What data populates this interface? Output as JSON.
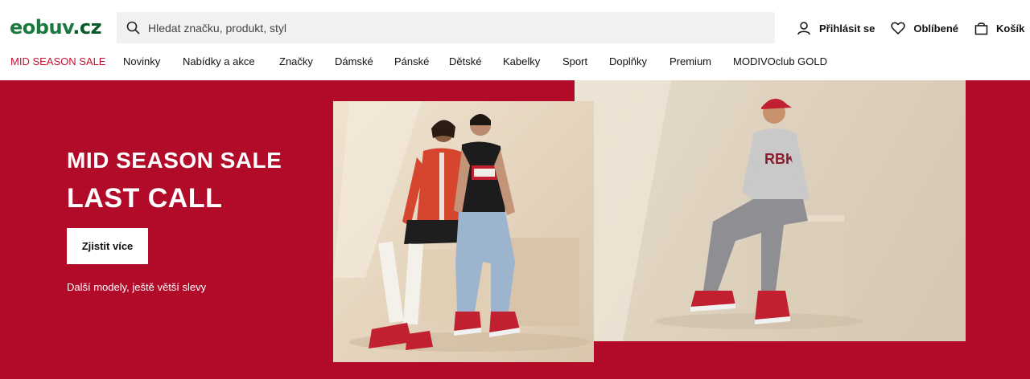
{
  "header": {
    "logo_main": "eobuv",
    "logo_tld": ".cz",
    "search_placeholder": "Hledat značku, produkt, styl",
    "actions": {
      "login": "Přihlásit se",
      "favorites": "Oblíbené",
      "cart": "Košík"
    }
  },
  "nav": {
    "items": [
      "MID SEASON SALE",
      "Novinky",
      "Nabídky a akce",
      "Značky",
      "Dámské",
      "Pánské",
      "Dětské",
      "Kabelky",
      "Sport",
      "Doplňky",
      "Premium",
      "MODIVOclub GOLD"
    ]
  },
  "hero": {
    "title": "MID SEASON SALE",
    "subtitle": "LAST CALL",
    "cta": "Zjistit více",
    "note": "Další modely, ještě větší slevy",
    "background_color": "#b10b29"
  },
  "colors": {
    "brand_green": "#1a7a3e",
    "sale_red": "#c8102e"
  }
}
